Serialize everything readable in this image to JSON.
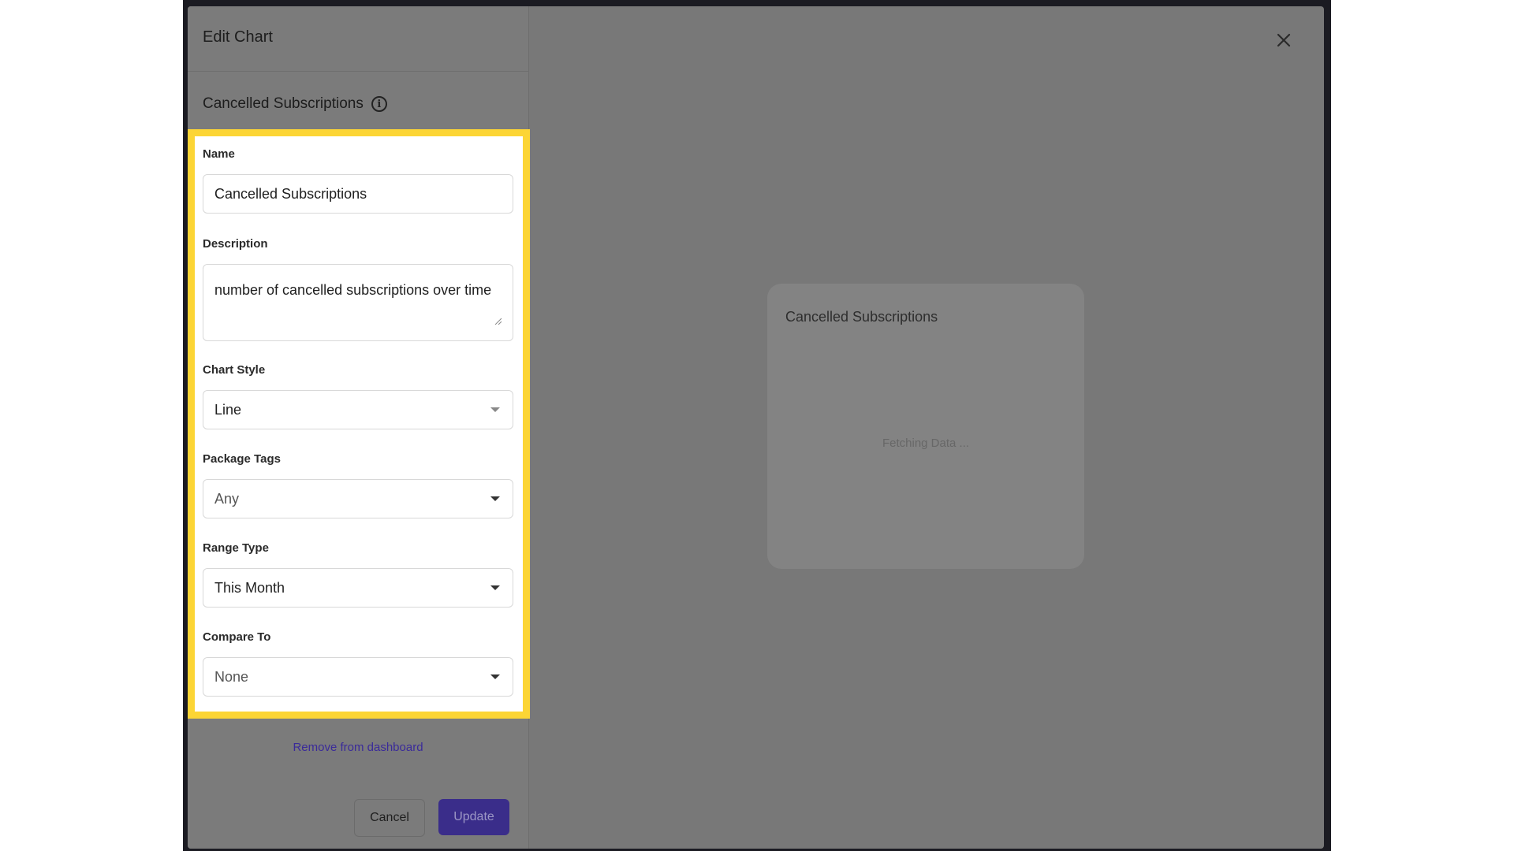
{
  "modal": {
    "title": "Edit Chart",
    "chart_heading": "Cancelled Subscriptions"
  },
  "form": {
    "name": {
      "label": "Name",
      "value": "Cancelled Subscriptions"
    },
    "description": {
      "label": "Description",
      "value": "number of cancelled subscriptions over time"
    },
    "chart_style": {
      "label": "Chart Style",
      "value": "Line"
    },
    "package_tags": {
      "label": "Package Tags",
      "value": "Any"
    },
    "range_type": {
      "label": "Range Type",
      "value": "This Month"
    },
    "compare_to": {
      "label": "Compare To",
      "value": "None"
    }
  },
  "actions": {
    "remove_label": "Remove from dashboard",
    "cancel_label": "Cancel",
    "update_label": "Update"
  },
  "preview": {
    "title": "Cancelled Subscriptions",
    "status": "Fetching Data ..."
  },
  "colors": {
    "highlight": "#fcd535",
    "accent": "#3a2d8a",
    "link": "#3a2a9a"
  },
  "icons": {
    "info": "info-icon",
    "close": "close-icon",
    "dropdown": "chevron-down-icon",
    "resize": "resize-handle-icon"
  }
}
